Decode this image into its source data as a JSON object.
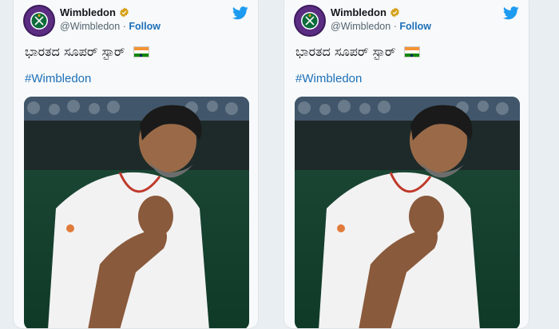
{
  "tweets": [
    {
      "account_name": "Wimbledon",
      "handle": "@Wimbledon",
      "separator": "·",
      "follow_label": "Follow",
      "text": "ಭಾರತದ ಸೂಪರ್ ಸ್ಟಾರ್",
      "hashtag": "#Wimbledon",
      "avatar_text": "THE CHAMPIONSHIPS WIMBLEDON",
      "verified_color": "#d4a017",
      "flag": "india-flag",
      "brand_icon": "twitter-bird-icon",
      "brand_color": "#1d9bf0",
      "photo": "player-celebrating-photo"
    },
    {
      "account_name": "Wimbledon",
      "handle": "@Wimbledon",
      "separator": "·",
      "follow_label": "Follow",
      "text": "ಭಾರತದ ಸೂಪರ್ ಸ್ಟಾರ್",
      "hashtag": "#Wimbledon",
      "avatar_text": "THE CHAMPIONSHIPS WIMBLEDON",
      "verified_color": "#d4a017",
      "flag": "india-flag",
      "brand_icon": "twitter-bird-icon",
      "brand_color": "#1d9bf0",
      "photo": "player-celebrating-photo"
    }
  ]
}
